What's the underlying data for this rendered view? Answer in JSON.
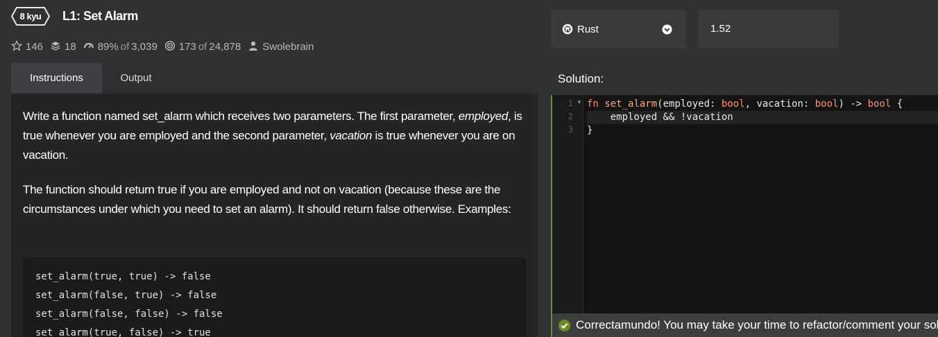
{
  "kata": {
    "rank": "8 kyu",
    "title": "L1: Set Alarm"
  },
  "stats": {
    "stars": "146",
    "collections": "18",
    "satisfaction": "89%",
    "satisfaction_of": "of",
    "satisfaction_votes": "3,039",
    "completions": "173",
    "completions_of": "of",
    "completions_total": "24,878",
    "author": "Swolebrain"
  },
  "language": {
    "selected": "Rust",
    "version": "1.52"
  },
  "tabs": [
    {
      "label": "Instructions",
      "active": true
    },
    {
      "label": "Output",
      "active": false
    }
  ],
  "description": {
    "p1_a": "Write a function named set_alarm which receives two parameters. The first parameter, ",
    "p1_b": "employed",
    "p1_c": ", is true whenever you are employed and the second parameter, ",
    "p1_d": "vacation",
    "p1_e": " is true whenever you are on vacation.",
    "p2": "The function should return true if you are employed and not on vacation (because these are the circumstances under which you need to set an alarm). It should return false otherwise. Examples:"
  },
  "examples": [
    "set_alarm(true, true) -> false",
    "set_alarm(false, true) -> false",
    "set_alarm(false, false) -> false",
    "set_alarm(true, false) -> true"
  ],
  "solution": {
    "label": "Solution:",
    "line_numbers": [
      "1",
      "2",
      "3"
    ],
    "code": {
      "l1_kw_fn": "fn",
      "l1_name": "set_alarm",
      "l1_a": "(employed: ",
      "l1_type1": "bool",
      "l1_b": ", vacation: ",
      "l1_type2": "bool",
      "l1_c": ") -> ",
      "l1_type3": "bool",
      "l1_d": " {",
      "l2": "    employed && !vacation",
      "l3": "}"
    }
  },
  "status": {
    "message": "Correctamundo! You may take your time to refactor/comment your solution.",
    "color": "#6b8e23"
  },
  "icons": {
    "stars": "star-outline-icon",
    "collections": "layers-icon",
    "satisfaction": "gauge-icon",
    "completions": "target-icon",
    "author": "user-icon",
    "language": "rust-icon",
    "dropdown": "chevron-down-icon",
    "success": "check-circle-icon"
  }
}
